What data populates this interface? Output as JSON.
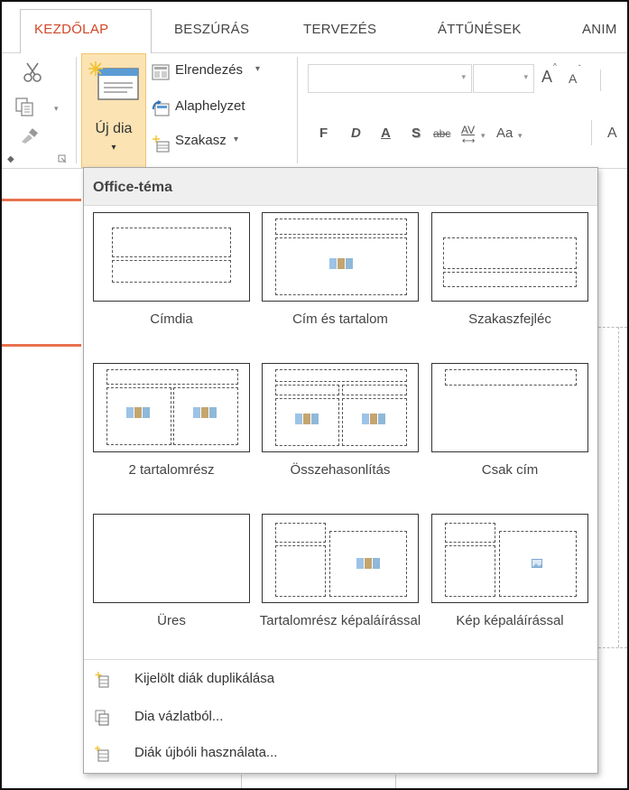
{
  "tabs": [
    {
      "label": "KEZDŐLAP",
      "active": true
    },
    {
      "label": "BESZÚRÁS"
    },
    {
      "label": "TERVEZÉS"
    },
    {
      "label": "ÁTTŰNÉSEK"
    },
    {
      "label": "ANIM"
    }
  ],
  "ribbon": {
    "new_slide_line1": "Új dia",
    "new_slide_arrow": "▾",
    "layout_label": "Elrendezés",
    "reset_label": "Alaphelyzet",
    "section_label": "Szakasz",
    "dropdown_caret": "▾",
    "font_buttons": {
      "grow": "A",
      "shrink": "A",
      "bold": "F",
      "italic": "D",
      "underline": "A",
      "shadow": "S",
      "strikethrough": "abc",
      "spacing": "AV",
      "case": "Aa",
      "font_color": "A"
    }
  },
  "dropdown": {
    "header": "Office-téma",
    "layouts": [
      {
        "name": "Címdia"
      },
      {
        "name": "Cím és tartalom"
      },
      {
        "name": "Szakaszfejléc"
      },
      {
        "name": "2 tartalomrész"
      },
      {
        "name": "Összehasonlítás"
      },
      {
        "name": "Csak cím"
      },
      {
        "name": "Üres"
      },
      {
        "name": "Tartalomrész képaláírással"
      },
      {
        "name": "Kép képaláírással"
      }
    ],
    "menu": [
      {
        "label": "Kijelölt diák duplikálása",
        "icon": "duplicate-slides-icon"
      },
      {
        "label": "Dia vázlatból...",
        "icon": "slides-from-outline-icon"
      },
      {
        "label": "Diák újbóli használata...",
        "icon": "reuse-slides-icon"
      }
    ]
  },
  "colors": {
    "accent": "#d24726",
    "tab_text": "#444444",
    "header_bg": "#efefef"
  }
}
